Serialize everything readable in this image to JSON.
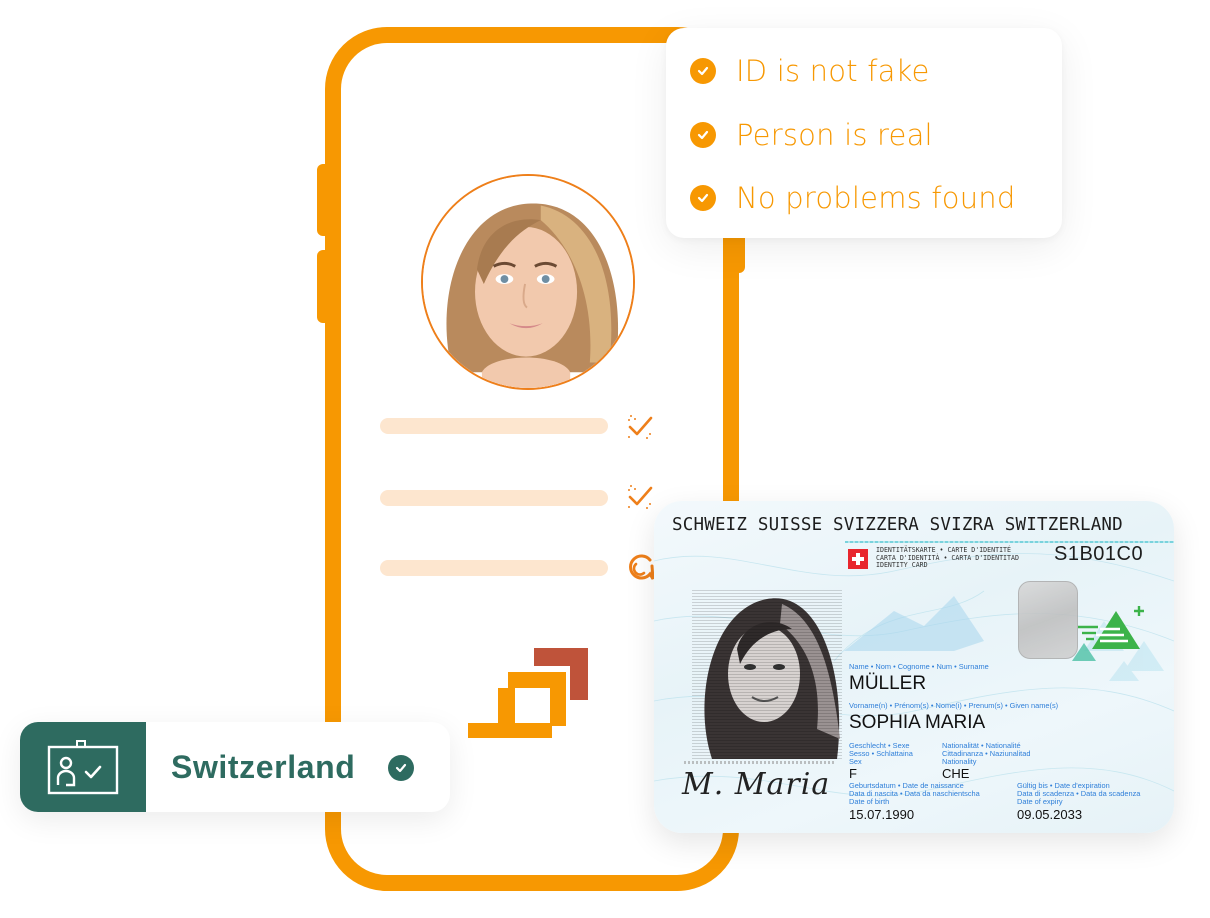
{
  "checklist": {
    "items": [
      {
        "label": "ID is not fake",
        "icon": "check-circle-icon"
      },
      {
        "label": "Person is real",
        "icon": "check-circle-icon"
      },
      {
        "label": "No problems found",
        "icon": "check-circle-icon"
      }
    ]
  },
  "phone": {
    "avatar_alt": "User selfie photo",
    "steps": [
      {
        "status": "verified",
        "icon": "sparkle-check-icon"
      },
      {
        "status": "verified",
        "icon": "sparkle-check-icon"
      },
      {
        "status": "in-progress",
        "icon": "chat-spinner-icon"
      }
    ]
  },
  "country_badge": {
    "icon": "id-badge-icon",
    "name": "Switzerland",
    "verified_icon": "check-circle-icon"
  },
  "id_card": {
    "header": "SCHWEIZ SUISSE SVIZZERA SVIZRA SWITZERLAND",
    "doc_type": "IDENTITÄTSKARTE • CARTE D'IDENTITÉ\nCARTA D'IDENTITÀ • CARTA D'IDENTITAD\nIDENTITY CARD",
    "doc_number": "S1B01C0",
    "surname_label": "Name • Nom • Cognome • Num • Surname",
    "surname": "MÜLLER",
    "given_label": "Vorname(n) • Prénom(s) • Nome(i) • Prenum(s) • Given name(s)",
    "given_names": "SOPHIA MARIA",
    "sex_label": "Geschlecht • Sexe\nSesso • Schlattaina\nSex",
    "sex": "F",
    "nationality_label": "Nationalität • Nationalité\nCittadinanza • Naziunalitad\nNationality",
    "nationality": "CHE",
    "dob_label": "Geburtsdatum • Date de naissance\nData di nascita • Data da naschientscha\nDate of birth",
    "dob": "15.07.1990",
    "expiry_label": "Gültig bis • Date d'expiration\nData di scadenza • Data da scadenza\nDate of expiry",
    "expiry": "09.05.2033",
    "signature": "M. Maria"
  },
  "colors": {
    "brand_orange": "#F79802",
    "accent_red": "#BF533A",
    "pill_bg": "#FDE6CF",
    "badge_green": "#2E6B60",
    "card_label_blue": "#2F7FD9"
  }
}
